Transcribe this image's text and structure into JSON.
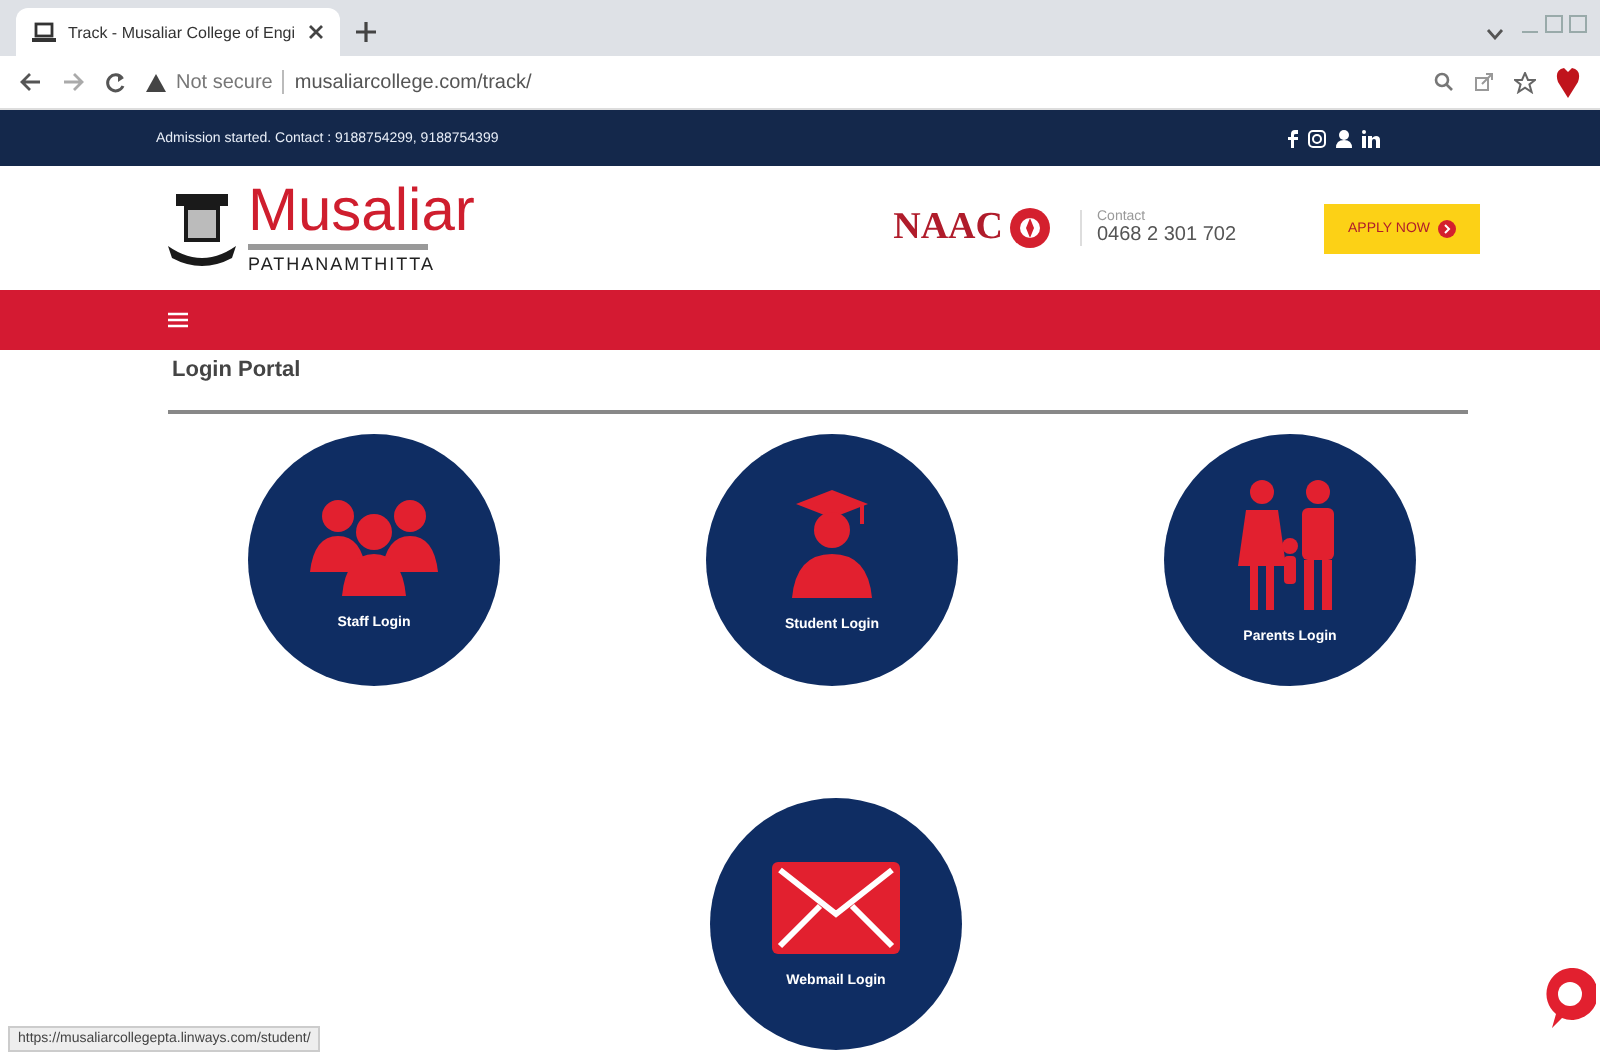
{
  "browser": {
    "tab_title": "Track - Musaliar College of Engi",
    "security": "Not secure",
    "address": "musaliarcollege.com/track/"
  },
  "topbar": {
    "notice": "Admission started. Contact : 9188754299, 9188754399"
  },
  "header": {
    "logo_name": "Musaliar",
    "logo_place": "PATHANAMTHITTA",
    "naac": "NAAC",
    "contact_label": "Contact",
    "contact_phone": "0468 2 301 702",
    "apply": "APPLY NOW"
  },
  "page": {
    "title": "Login Portal"
  },
  "portals": [
    {
      "label": "Staff Login",
      "kind": "staff"
    },
    {
      "label": "Student Login",
      "kind": "student"
    },
    {
      "label": "Parents Login",
      "kind": "parents"
    },
    {
      "label": "Webmail Login",
      "kind": "mail"
    }
  ],
  "status_url": "https://musaliarcollegepta.linways.com/student/"
}
